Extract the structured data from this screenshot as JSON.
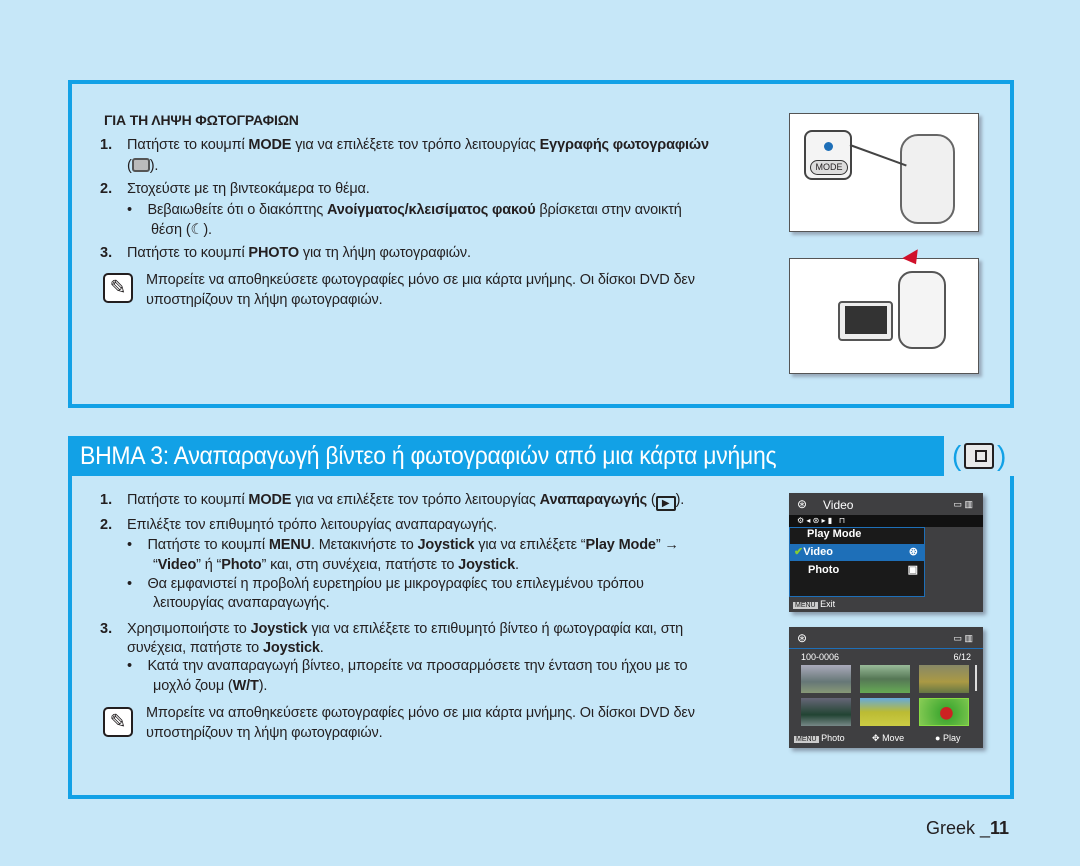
{
  "section1": {
    "heading": "ΓΙΑ ΤΗ ΛΗΨΗ ΦΩΤΟΓΡΑΦΙΩΝ",
    "step1": {
      "num": "1.",
      "a": "Πατήστε το κουμπί ",
      "b": "MODE",
      "c": " για να επιλέξετε τον τρόπο λειτουργίας ",
      "d": "Εγγραφής φωτογραφιών",
      "e": "(",
      "f": ")."
    },
    "step2": {
      "num": "2.",
      "text": "Στοχεύστε με τη βιντεοκάμερα το θέμα."
    },
    "bullet1": {
      "a": "Βεβαιωθείτε ότι ο διακόπτης ",
      "b": "Ανοίγματος/κλεισίματος φακού",
      "c": " βρίσκεται στην ανοικτή",
      "d": "θέση  (",
      "e": ")."
    },
    "step3": {
      "num": "3.",
      "a": "Πατήστε το κουμπί ",
      "b": "PHOTO",
      "c": " για τη λήψη φωτογραφιών."
    },
    "note": {
      "line1": "Μπορείτε να αποθηκεύσετε φωτογραφίες μόνο σε μια κάρτα μνήμης. Οι δίσκοι DVD δεν",
      "line2": "υποστηρίζουν τη λήψη φωτογραφιών."
    },
    "illustration_label": "MODE"
  },
  "banner": {
    "title": "ΒΗΜΑ 3: Αναπαραγωγή βίντεο ή φωτογραφιών από μια κάρτα μνήμης",
    "paren_open": "(",
    "paren_close": ")",
    "icon": "memory-card-play-icon"
  },
  "section2": {
    "step1": {
      "num": "1.",
      "a": "Πατήστε το κουμπί ",
      "b": "MODE",
      "c": " για να επιλέξετε τον τρόπο λειτουργίας ",
      "d": "Αναπαραγωγής",
      "e": " (",
      "f": ")."
    },
    "step2": {
      "num": "2.",
      "text": "Επιλέξτε τον επιθυμητό τρόπο λειτουργίας αναπαραγωγής."
    },
    "bullet1": {
      "a": "Πατήστε το κουμπί ",
      "b": "MENU",
      "c": ". Μετακινήστε το ",
      "d": "Joystick",
      "e": " για να επιλέξετε “",
      "f": "Play Mode",
      "g": "” →",
      "h": "“",
      "i": "Video",
      "j": "” ή “",
      "k": "Photo",
      "l": "” και, στη συνέχεια, πατήστε το ",
      "m": "Joystick",
      "n": "."
    },
    "bullet2": {
      "line1": "Θα εμφανιστεί η προβολή ευρετηρίου με μικρογραφίες του επιλεγμένου τρόπου",
      "line2": "λειτουργίας αναπαραγωγής."
    },
    "step3": {
      "num": "3.",
      "a": "Χρησιμοποιήστε το ",
      "b": "Joystick",
      "c": " για να επιλέξετε το επιθυμητό βίντεο ή φωτογραφία και, στη",
      "d": "συνέχεια, πατήστε το ",
      "e": "Joystick",
      "f": "."
    },
    "bullet3": {
      "a": "Κατά την αναπαραγωγή βίντεο, μπορείτε να προσαρμόσετε την ένταση του ήχου με το",
      "b": "μοχλό ζουμ (",
      "c": "W/T",
      "d": ")."
    },
    "note": {
      "line1": "Μπορείτε να αποθηκεύσετε φωτογραφίες μόνο σε μια κάρτα μνήμης. Οι δίσκοι DVD δεν",
      "line2": "υποστηρίζουν τη λήψη φωτογραφιών."
    }
  },
  "screen1": {
    "title": "Video",
    "menu_title": "Play Mode",
    "items": [
      {
        "label": "Video",
        "selected": true
      },
      {
        "label": "Photo",
        "selected": false
      }
    ],
    "menu_key": "MENU",
    "exit": "Exit"
  },
  "screen2": {
    "file": "100-0006",
    "count": "6/12",
    "menu_key": "MENU",
    "photo": "Photo",
    "move": "Move",
    "play": "Play"
  },
  "footer": {
    "lang": "Greek _",
    "page": "11"
  },
  "colors": {
    "accent": "#12a1e6",
    "background": "#c6e7f8",
    "highlight": "#1e6fb8"
  }
}
